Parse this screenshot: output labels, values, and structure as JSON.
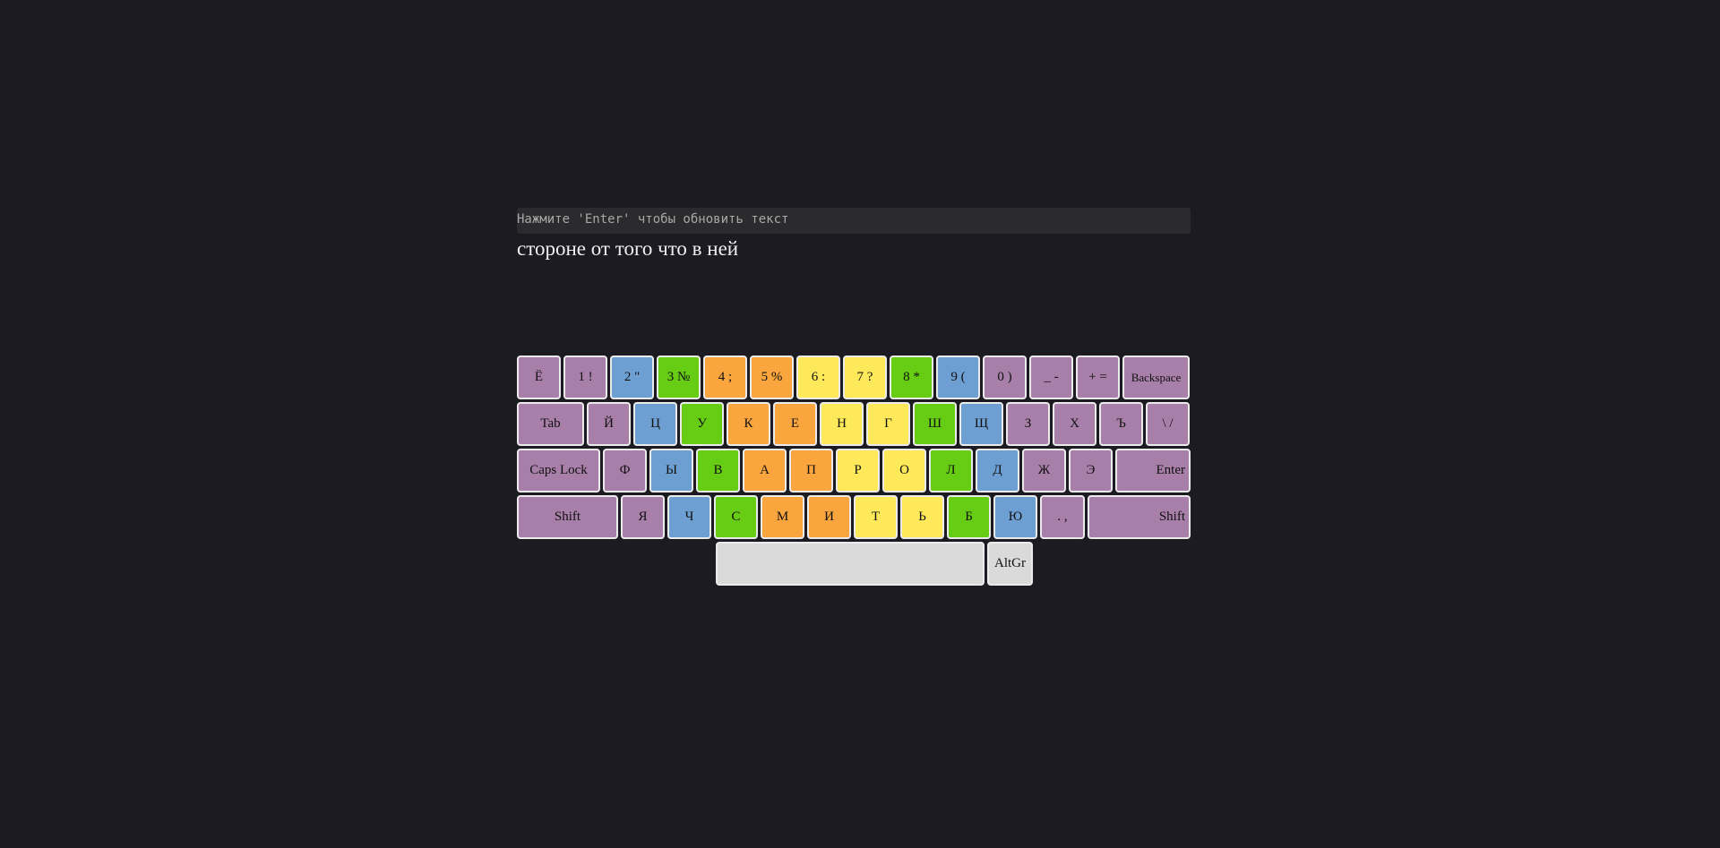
{
  "hint_text": "Нажмите 'Enter' чтобы обновить текст",
  "typed_text": "стороне от того что в ней",
  "colors": {
    "purple": "#a87fa9",
    "blue": "#6e9fd2",
    "green": "#66cc14",
    "orange": "#fba53e",
    "yellow": "#fde95a",
    "gray": "#dadada",
    "background": "#1c1b21"
  },
  "keyboard": {
    "rows": [
      [
        {
          "id": "yo",
          "label": "Ё",
          "color": "purple"
        },
        {
          "id": "1",
          "label": "1 !",
          "color": "purple"
        },
        {
          "id": "2",
          "label": "2 \"",
          "color": "blue"
        },
        {
          "id": "3",
          "label": "3 №",
          "color": "green"
        },
        {
          "id": "4",
          "label": "4 ;",
          "color": "orange"
        },
        {
          "id": "5",
          "label": "5 %",
          "color": "orange"
        },
        {
          "id": "6",
          "label": "6 :",
          "color": "yellow"
        },
        {
          "id": "7",
          "label": "7 ?",
          "color": "yellow"
        },
        {
          "id": "8",
          "label": "8 *",
          "color": "green"
        },
        {
          "id": "9",
          "label": "9 (",
          "color": "blue"
        },
        {
          "id": "0",
          "label": "0 )",
          "color": "purple"
        },
        {
          "id": "minus",
          "label": "_ -",
          "color": "purple"
        },
        {
          "id": "equals",
          "label": "+ =",
          "color": "purple"
        },
        {
          "id": "backspace",
          "label": "Backspace",
          "color": "purple"
        }
      ],
      [
        {
          "id": "tab",
          "label": "Tab",
          "color": "purple"
        },
        {
          "id": "y-short",
          "label": "Й",
          "color": "purple"
        },
        {
          "id": "ts",
          "label": "Ц",
          "color": "blue"
        },
        {
          "id": "u",
          "label": "У",
          "color": "green"
        },
        {
          "id": "k",
          "label": "К",
          "color": "orange"
        },
        {
          "id": "ye",
          "label": "Е",
          "color": "orange"
        },
        {
          "id": "n",
          "label": "Н",
          "color": "yellow"
        },
        {
          "id": "g",
          "label": "Г",
          "color": "yellow"
        },
        {
          "id": "sh",
          "label": "Ш",
          "color": "green"
        },
        {
          "id": "shch",
          "label": "Щ",
          "color": "blue"
        },
        {
          "id": "z",
          "label": "З",
          "color": "purple"
        },
        {
          "id": "kh",
          "label": "Х",
          "color": "purple"
        },
        {
          "id": "hard-sign",
          "label": "Ъ",
          "color": "purple"
        },
        {
          "id": "backslash",
          "label": "\\ /",
          "color": "purple"
        }
      ],
      [
        {
          "id": "caps-lock",
          "label": "Caps Lock",
          "color": "purple"
        },
        {
          "id": "f",
          "label": "Ф",
          "color": "purple"
        },
        {
          "id": "yery",
          "label": "Ы",
          "color": "blue"
        },
        {
          "id": "v",
          "label": "В",
          "color": "green"
        },
        {
          "id": "a",
          "label": "А",
          "color": "orange"
        },
        {
          "id": "p",
          "label": "П",
          "color": "orange"
        },
        {
          "id": "r",
          "label": "Р",
          "color": "yellow"
        },
        {
          "id": "o",
          "label": "О",
          "color": "yellow"
        },
        {
          "id": "l",
          "label": "Л",
          "color": "green"
        },
        {
          "id": "d",
          "label": "Д",
          "color": "blue"
        },
        {
          "id": "zh",
          "label": "Ж",
          "color": "purple"
        },
        {
          "id": "e",
          "label": "Э",
          "color": "purple"
        },
        {
          "id": "enter",
          "label": "Enter",
          "color": "purple"
        }
      ],
      [
        {
          "id": "shift-left",
          "label": "Shift",
          "color": "purple"
        },
        {
          "id": "ya",
          "label": "Я",
          "color": "purple"
        },
        {
          "id": "ch",
          "label": "Ч",
          "color": "blue"
        },
        {
          "id": "s",
          "label": "С",
          "color": "green"
        },
        {
          "id": "m",
          "label": "М",
          "color": "orange"
        },
        {
          "id": "i",
          "label": "И",
          "color": "orange"
        },
        {
          "id": "t",
          "label": "Т",
          "color": "yellow"
        },
        {
          "id": "soft-sign",
          "label": "Ь",
          "color": "yellow"
        },
        {
          "id": "b",
          "label": "Б",
          "color": "green"
        },
        {
          "id": "yu",
          "label": "Ю",
          "color": "blue"
        },
        {
          "id": "period",
          "label": ". ,",
          "color": "purple"
        },
        {
          "id": "shift-right",
          "label": "Shift",
          "color": "purple"
        }
      ],
      [
        {
          "id": "space",
          "label": "",
          "color": "gray"
        },
        {
          "id": "altgr",
          "label": "AltGr",
          "color": "gray"
        }
      ]
    ]
  }
}
